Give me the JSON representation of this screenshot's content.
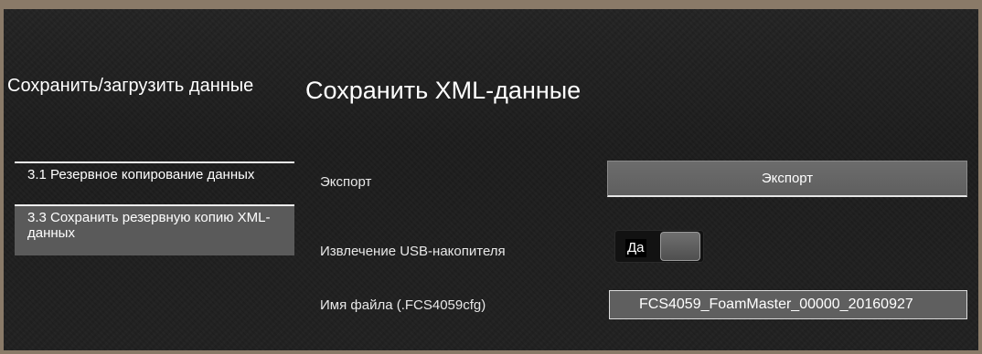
{
  "sidebar": {
    "title": "Сохранить/загрузить данные",
    "items": [
      {
        "label": "3.1 Резервное копирование данных",
        "selected": false
      },
      {
        "label": "3.3 Сохранить резервную копию XML-данных",
        "selected": true
      }
    ]
  },
  "main": {
    "title": "Сохранить XML-данные",
    "export": {
      "label": "Экспорт",
      "button_label": "Экспорт"
    },
    "usb_eject": {
      "label": "Извлечение USB-накопителя",
      "value": "Да"
    },
    "filename": {
      "label": "Имя файла (.FCS4059cfg)",
      "value": "FCS4059_FoamMaster_00000_20160927"
    }
  },
  "colors": {
    "background": "#1f1f1f",
    "border": "#8a7a68",
    "selected_item": "#5a5a5a",
    "button": "#666666"
  }
}
